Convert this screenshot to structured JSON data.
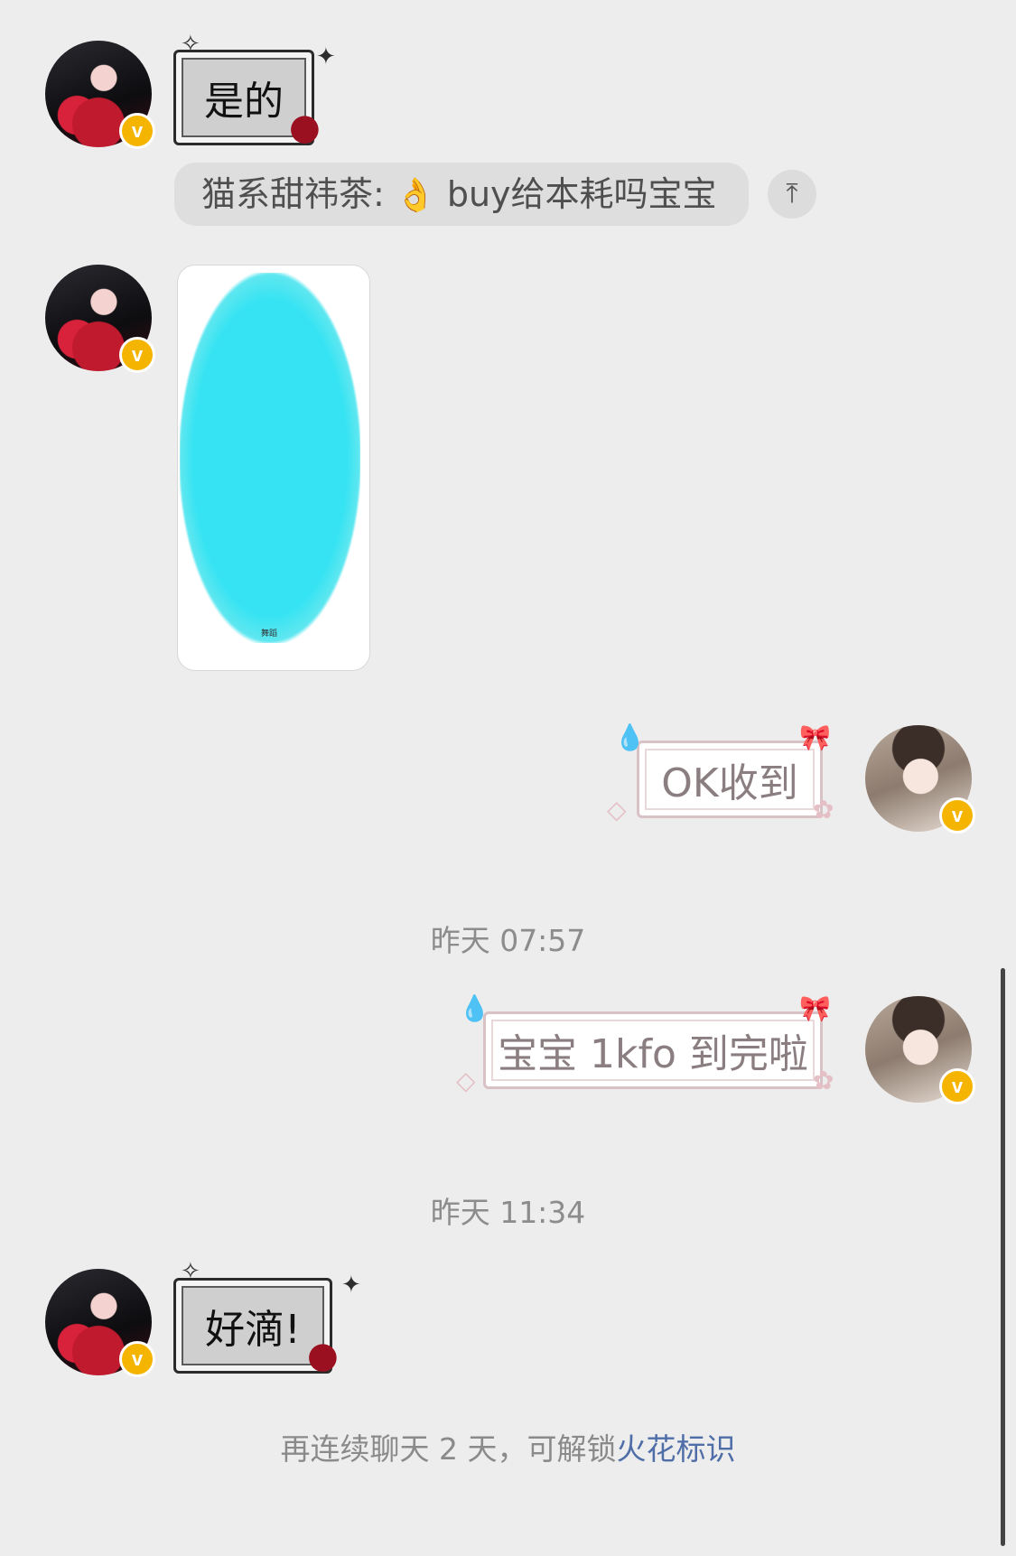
{
  "messages": {
    "m1": {
      "text": "是的"
    },
    "quote": {
      "sender": "猫系甜祎茶:",
      "emoji": "👌",
      "text": "buy给本耗吗宝宝"
    },
    "image_caption": "舞蹈",
    "m3": {
      "text": "OK收到"
    },
    "time1": "昨天 07:57",
    "m4": {
      "text": "宝宝 1kfo 到完啦"
    },
    "time2": "昨天 11:34",
    "m5": {
      "text": "好滴!"
    }
  },
  "footer": {
    "prefix": "再连续聊天 2 天，可解锁",
    "link": "火花标识"
  },
  "badge": "v",
  "pin_icon": "⤒"
}
